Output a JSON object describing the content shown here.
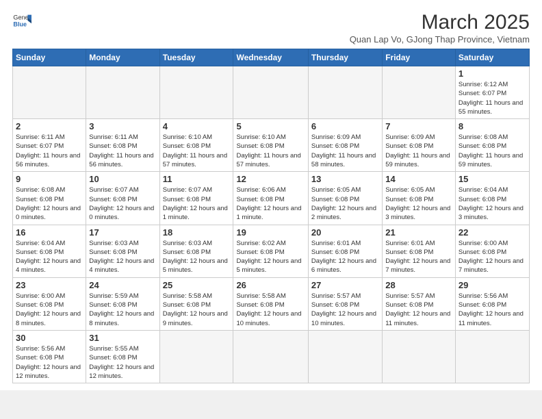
{
  "logo": {
    "text_general": "General",
    "text_blue": "Blue"
  },
  "header": {
    "month": "March 2025",
    "location": "Quan Lap Vo, GJong Thap Province, Vietnam"
  },
  "weekdays": [
    "Sunday",
    "Monday",
    "Tuesday",
    "Wednesday",
    "Thursday",
    "Friday",
    "Saturday"
  ],
  "weeks": [
    [
      {
        "day": "",
        "info": ""
      },
      {
        "day": "",
        "info": ""
      },
      {
        "day": "",
        "info": ""
      },
      {
        "day": "",
        "info": ""
      },
      {
        "day": "",
        "info": ""
      },
      {
        "day": "",
        "info": ""
      },
      {
        "day": "1",
        "info": "Sunrise: 6:12 AM\nSunset: 6:07 PM\nDaylight: 11 hours\nand 55 minutes."
      }
    ],
    [
      {
        "day": "2",
        "info": "Sunrise: 6:11 AM\nSunset: 6:07 PM\nDaylight: 11 hours\nand 56 minutes."
      },
      {
        "day": "3",
        "info": "Sunrise: 6:11 AM\nSunset: 6:08 PM\nDaylight: 11 hours\nand 56 minutes."
      },
      {
        "day": "4",
        "info": "Sunrise: 6:10 AM\nSunset: 6:08 PM\nDaylight: 11 hours\nand 57 minutes."
      },
      {
        "day": "5",
        "info": "Sunrise: 6:10 AM\nSunset: 6:08 PM\nDaylight: 11 hours\nand 57 minutes."
      },
      {
        "day": "6",
        "info": "Sunrise: 6:09 AM\nSunset: 6:08 PM\nDaylight: 11 hours\nand 58 minutes."
      },
      {
        "day": "7",
        "info": "Sunrise: 6:09 AM\nSunset: 6:08 PM\nDaylight: 11 hours\nand 59 minutes."
      },
      {
        "day": "8",
        "info": "Sunrise: 6:08 AM\nSunset: 6:08 PM\nDaylight: 11 hours\nand 59 minutes."
      }
    ],
    [
      {
        "day": "9",
        "info": "Sunrise: 6:08 AM\nSunset: 6:08 PM\nDaylight: 12 hours\nand 0 minutes."
      },
      {
        "day": "10",
        "info": "Sunrise: 6:07 AM\nSunset: 6:08 PM\nDaylight: 12 hours\nand 0 minutes."
      },
      {
        "day": "11",
        "info": "Sunrise: 6:07 AM\nSunset: 6:08 PM\nDaylight: 12 hours\nand 1 minute."
      },
      {
        "day": "12",
        "info": "Sunrise: 6:06 AM\nSunset: 6:08 PM\nDaylight: 12 hours\nand 1 minute."
      },
      {
        "day": "13",
        "info": "Sunrise: 6:05 AM\nSunset: 6:08 PM\nDaylight: 12 hours\nand 2 minutes."
      },
      {
        "day": "14",
        "info": "Sunrise: 6:05 AM\nSunset: 6:08 PM\nDaylight: 12 hours\nand 3 minutes."
      },
      {
        "day": "15",
        "info": "Sunrise: 6:04 AM\nSunset: 6:08 PM\nDaylight: 12 hours\nand 3 minutes."
      }
    ],
    [
      {
        "day": "16",
        "info": "Sunrise: 6:04 AM\nSunset: 6:08 PM\nDaylight: 12 hours\nand 4 minutes."
      },
      {
        "day": "17",
        "info": "Sunrise: 6:03 AM\nSunset: 6:08 PM\nDaylight: 12 hours\nand 4 minutes."
      },
      {
        "day": "18",
        "info": "Sunrise: 6:03 AM\nSunset: 6:08 PM\nDaylight: 12 hours\nand 5 minutes."
      },
      {
        "day": "19",
        "info": "Sunrise: 6:02 AM\nSunset: 6:08 PM\nDaylight: 12 hours\nand 5 minutes."
      },
      {
        "day": "20",
        "info": "Sunrise: 6:01 AM\nSunset: 6:08 PM\nDaylight: 12 hours\nand 6 minutes."
      },
      {
        "day": "21",
        "info": "Sunrise: 6:01 AM\nSunset: 6:08 PM\nDaylight: 12 hours\nand 7 minutes."
      },
      {
        "day": "22",
        "info": "Sunrise: 6:00 AM\nSunset: 6:08 PM\nDaylight: 12 hours\nand 7 minutes."
      }
    ],
    [
      {
        "day": "23",
        "info": "Sunrise: 6:00 AM\nSunset: 6:08 PM\nDaylight: 12 hours\nand 8 minutes."
      },
      {
        "day": "24",
        "info": "Sunrise: 5:59 AM\nSunset: 6:08 PM\nDaylight: 12 hours\nand 8 minutes."
      },
      {
        "day": "25",
        "info": "Sunrise: 5:58 AM\nSunset: 6:08 PM\nDaylight: 12 hours\nand 9 minutes."
      },
      {
        "day": "26",
        "info": "Sunrise: 5:58 AM\nSunset: 6:08 PM\nDaylight: 12 hours\nand 10 minutes."
      },
      {
        "day": "27",
        "info": "Sunrise: 5:57 AM\nSunset: 6:08 PM\nDaylight: 12 hours\nand 10 minutes."
      },
      {
        "day": "28",
        "info": "Sunrise: 5:57 AM\nSunset: 6:08 PM\nDaylight: 12 hours\nand 11 minutes."
      },
      {
        "day": "29",
        "info": "Sunrise: 5:56 AM\nSunset: 6:08 PM\nDaylight: 12 hours\nand 11 minutes."
      }
    ],
    [
      {
        "day": "30",
        "info": "Sunrise: 5:56 AM\nSunset: 6:08 PM\nDaylight: 12 hours\nand 12 minutes."
      },
      {
        "day": "31",
        "info": "Sunrise: 5:55 AM\nSunset: 6:08 PM\nDaylight: 12 hours\nand 12 minutes."
      },
      {
        "day": "",
        "info": ""
      },
      {
        "day": "",
        "info": ""
      },
      {
        "day": "",
        "info": ""
      },
      {
        "day": "",
        "info": ""
      },
      {
        "day": "",
        "info": ""
      }
    ]
  ]
}
